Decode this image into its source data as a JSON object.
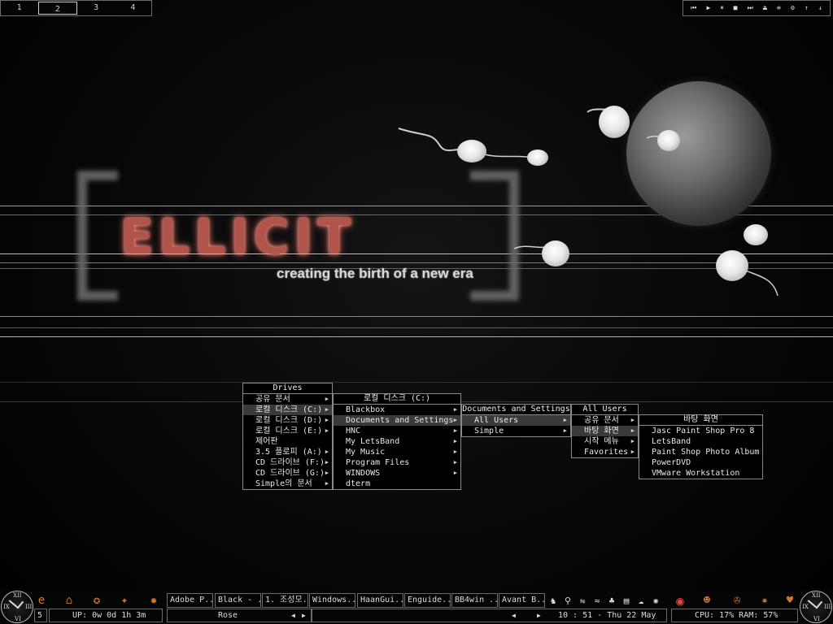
{
  "pager": {
    "workspaces": [
      "1",
      "2",
      "3",
      "4"
    ],
    "active": "2"
  },
  "media_controls": [
    "⏮",
    "▶",
    "⏸",
    "■",
    "⏭",
    "⏏",
    "≡",
    "⚙",
    "↑",
    "↓"
  ],
  "wallpaper": {
    "logo": "ELLICIT",
    "tagline": "creating the birth of a new era"
  },
  "menus": {
    "drives": {
      "title": "Drives",
      "items": [
        {
          "label": "공유 문서",
          "arrow": true
        },
        {
          "label": "로컬 디스크 (C:)",
          "arrow": true,
          "selected": true
        },
        {
          "label": "로컬 디스크 (D:)",
          "arrow": true
        },
        {
          "label": "로컬 디스크 (E:)",
          "arrow": true
        },
        {
          "label": "제어판",
          "arrow": false
        },
        {
          "label": "3.5 플로피 (A:)",
          "arrow": true
        },
        {
          "label": "CD 드라이브 (F:)",
          "arrow": true
        },
        {
          "label": "CD 드라이브 (G:)",
          "arrow": true
        },
        {
          "label": "Simple의 문서",
          "arrow": true
        }
      ]
    },
    "local_disk_c": {
      "title": "로컬 디스크 (C:)",
      "items": [
        {
          "label": "Blackbox",
          "arrow": true
        },
        {
          "label": "Documents and Settings",
          "arrow": true,
          "selected": true
        },
        {
          "label": "HNC",
          "arrow": true
        },
        {
          "label": "My LetsBand",
          "arrow": true
        },
        {
          "label": "My Music",
          "arrow": true
        },
        {
          "label": "Program Files",
          "arrow": true
        },
        {
          "label": "WINDOWS",
          "arrow": true
        },
        {
          "label": "dterm",
          "arrow": false
        }
      ]
    },
    "documents_and_settings": {
      "title": "Documents and Settings",
      "items": [
        {
          "label": "All Users",
          "arrow": true,
          "selected": true
        },
        {
          "label": "Simple",
          "arrow": true
        }
      ]
    },
    "all_users": {
      "title": "All Users",
      "items": [
        {
          "label": "공유 문서",
          "arrow": true
        },
        {
          "label": "바탕 화면",
          "arrow": true,
          "selected": true
        },
        {
          "label": "시작 메뉴",
          "arrow": true
        },
        {
          "label": "Favorites",
          "arrow": true
        }
      ]
    },
    "desktop": {
      "title": "바탕 화면",
      "items": [
        {
          "label": "Jasc Paint Shop Pro 8",
          "arrow": false
        },
        {
          "label": "LetsBand",
          "arrow": false
        },
        {
          "label": "Paint Shop Photo Album",
          "arrow": false
        },
        {
          "label": "PowerDVD",
          "arrow": false
        },
        {
          "label": "VMware Workstation",
          "arrow": false
        }
      ]
    }
  },
  "clock_left": {
    "numerals": [
      "XII",
      "III",
      "VI",
      "IX"
    ]
  },
  "clock_right": {
    "numerals": [
      "XII",
      "III",
      "VI",
      "IX"
    ]
  },
  "quicklaunch_left": [
    {
      "name": "internet-explorer-icon",
      "glyph": "e"
    },
    {
      "name": "house-icon",
      "glyph": "⌂"
    },
    {
      "name": "media-icon",
      "glyph": "✪"
    },
    {
      "name": "tool-icon",
      "glyph": "✦"
    },
    {
      "name": "fire-icon",
      "glyph": "✹"
    }
  ],
  "taskbar": {
    "tasks": [
      "Adobe P...",
      "Black - ...",
      "1. 조성모...",
      "Windows...",
      "HaanGui...",
      "Enguide...",
      "BB4win ...",
      "Avant B..."
    ],
    "current_task": "Rose",
    "workspace_number": "5",
    "uptime": "UP: 0w 0d 1h 3m",
    "clock": "10 : 51   -   Thu 22 May",
    "system": "CPU: 17%  RAM: 57%"
  },
  "tray_icons": [
    {
      "name": "wizard-icon",
      "glyph": "♞"
    },
    {
      "name": "pin-icon",
      "glyph": "⚲"
    },
    {
      "name": "network-icon",
      "glyph": "⇋"
    },
    {
      "name": "wifi-icon",
      "glyph": "≈"
    },
    {
      "name": "people-icon",
      "glyph": "♣"
    },
    {
      "name": "note-icon",
      "glyph": "▤"
    },
    {
      "name": "ghost-icon",
      "glyph": "☁"
    },
    {
      "name": "settings-icon",
      "glyph": "✺"
    },
    {
      "name": "disc-icon",
      "glyph": "◉"
    }
  ],
  "quicklaunch_right": [
    {
      "name": "pacman-icon",
      "glyph": "☻"
    },
    {
      "name": "gear-icon",
      "glyph": "✇"
    },
    {
      "name": "planet-icon",
      "glyph": "✷"
    },
    {
      "name": "heart-icon",
      "glyph": "♥"
    }
  ],
  "colors": {
    "logo": "#b0544c",
    "logo_glow": "#ff7a6c",
    "border": "#6b6b6b",
    "menu_selected": "#3a3a3a",
    "icon_orange": "#d07a2a"
  }
}
